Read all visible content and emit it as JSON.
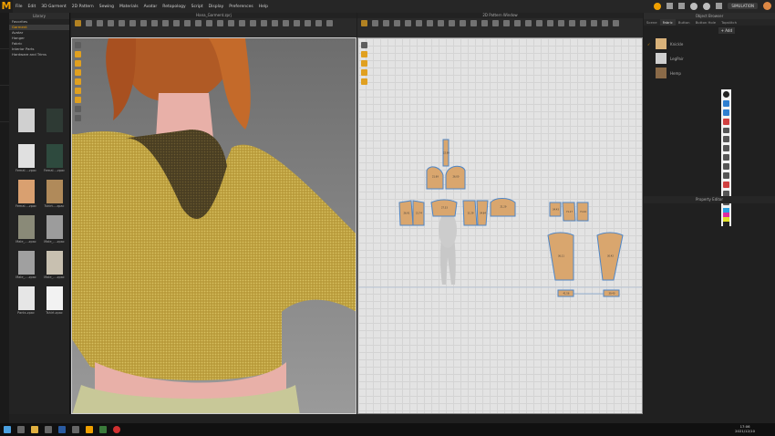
{
  "app": {
    "menus": [
      "File",
      "Edit",
      "3D Garment",
      "2D Pattern",
      "Sewing",
      "Materials",
      "Avatar",
      "Retopology",
      "Script",
      "Display",
      "Preferences",
      "Help"
    ],
    "mode_badge": "SIMULATION"
  },
  "library": {
    "title": "Library",
    "tree": [
      "Favorites",
      "Garment",
      "Avatar",
      "Hanger",
      "Fabric",
      "Interior Parts",
      "Hardware and Trims"
    ],
    "active_index": 1,
    "thumbs": [
      {
        "label": "",
        "color": "#d0d0d0"
      },
      {
        "label": "",
        "color": "#2e3a34"
      },
      {
        "label": "Femal....zpac",
        "color": "#e0e0e0"
      },
      {
        "label": "Femal....zpac",
        "color": "#2e4a3e"
      },
      {
        "label": "Femal....zpac",
        "color": "#d9a070"
      },
      {
        "label": "Tshirt....zpac",
        "color": "#b08a5a"
      },
      {
        "label": "Male_....zpac",
        "color": "#8a8a78"
      },
      {
        "label": "Male_....zpac",
        "color": "#9c9c9c"
      },
      {
        "label": "Male_....zpac",
        "color": "#a0a0a0"
      },
      {
        "label": "Male_....zpac",
        "color": "#c8c0b0"
      },
      {
        "label": "Pants.zpac",
        "color": "#e6e6e6"
      },
      {
        "label": "Tshirt.zpac",
        "color": "#f2f2f2"
      }
    ]
  },
  "viewport3d": {
    "title": "Hana_Garment.zprj"
  },
  "viewport2d": {
    "title": "2D Pattern Window",
    "pieces": [
      {
        "label": "22.90"
      },
      {
        "label": "21.69"
      },
      {
        "label": "26.00"
      },
      {
        "label": "26.91"
      },
      {
        "label": "21.74"
      },
      {
        "label": "27.33"
      },
      {
        "label": "11.29"
      },
      {
        "label": "34.64"
      },
      {
        "label": "21.29"
      },
      {
        "label": "34.43"
      },
      {
        "label": "71.17"
      },
      {
        "label": "71.24"
      },
      {
        "label": "36.11"
      },
      {
        "label": "30.42"
      },
      {
        "label": "41.56"
      },
      {
        "label": "39.40"
      }
    ]
  },
  "object_browser": {
    "title": "Object Browser",
    "tabs": [
      "Scene",
      "Fabric",
      "Button",
      "Button Hole",
      "Topstitch"
    ],
    "active_tab": 1,
    "add_label": "+ Add",
    "items": [
      {
        "label": "Knickle",
        "color": "#d9b27a"
      },
      {
        "label": "LegPair",
        "color": "#cfcfcf"
      },
      {
        "label": "Hemp",
        "color": "#8a6a48"
      }
    ]
  },
  "property_editor": {
    "title": "Property Editor"
  },
  "taskbar": {
    "time": "17:06",
    "date": "2021/12/10"
  },
  "colors": {
    "accent": "#f0a000",
    "fabric": "#d9a66e",
    "outline": "#4f86c6"
  }
}
